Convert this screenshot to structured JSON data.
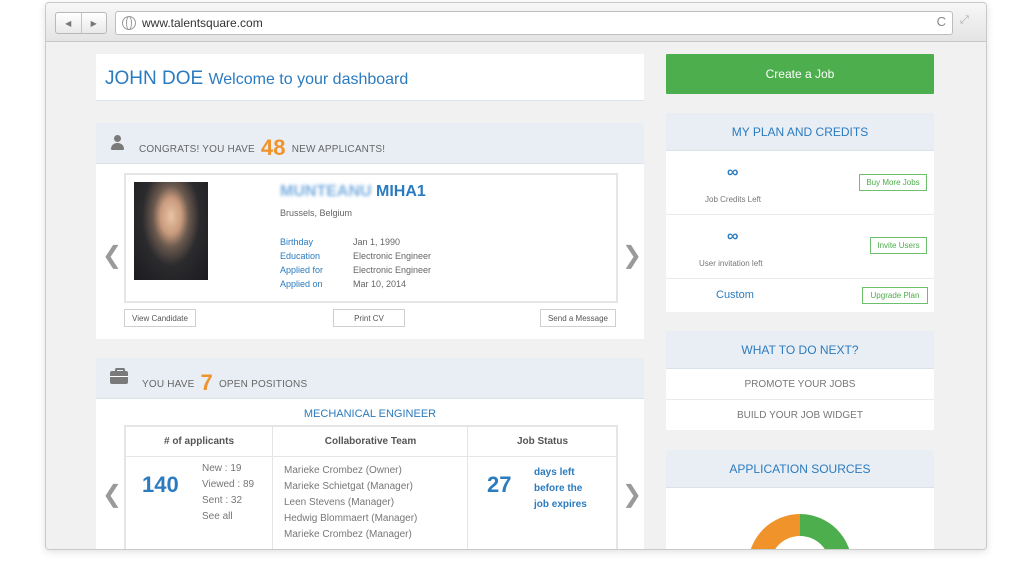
{
  "browser": {
    "url": "www.talentsquare.com",
    "back_icon": "◀",
    "forward_icon": "▶",
    "reload_icon": "C",
    "expand_icon": "⤢"
  },
  "welcome": {
    "name": "JOHN DOE",
    "message": "Welcome to your dashboard"
  },
  "create_job_label": "Create a Job",
  "applicants": {
    "prefix": "CONGRATS! YOU HAVE",
    "count": "48",
    "suffix": "NEW APPLICANTS!",
    "candidate": {
      "last_name": "MUNTEANU",
      "first_name": "MIHA1",
      "location": "Brussels, Belgium",
      "details": [
        {
          "label": "Birthday",
          "value": "Jan 1, 1990"
        },
        {
          "label": "Education",
          "value": "Electronic Engineer"
        },
        {
          "label": "Applied for",
          "value": "Electronic Engineer"
        },
        {
          "label": "Applied on",
          "value": "Mar 10, 2014"
        }
      ]
    },
    "view_candidate": "View Candidate",
    "print_cv": "Print CV",
    "send_message": "Send a Message",
    "prev_icon": "❮",
    "next_icon": "❯"
  },
  "positions": {
    "prefix": "YOU HAVE",
    "count": "7",
    "suffix": "OPEN POSITIONS",
    "title": "MECHANICAL ENGINEER",
    "headers": [
      "# of applicants",
      "Collaborative Team",
      "Job Status"
    ],
    "applicants_total": "140",
    "new": "New : 19",
    "viewed": "Viewed : 89",
    "sent": "Sent : 32",
    "see_all": "See all",
    "team": [
      "Marieke Crombez (Owner)",
      "Marieke Schietgat (Manager)",
      "Leen Stevens (Manager)",
      "Hedwig Blommaert (Manager)",
      "Marieke Crombez (Manager)"
    ],
    "days_left": "27",
    "days_text": [
      "days left",
      "before the",
      "job expires"
    ]
  },
  "plan": {
    "title": "MY PLAN AND CREDITS",
    "job_credits_value": "∞",
    "job_credits_label": "Job Credits Left",
    "buy_more": "Buy More Jobs",
    "invitations_value": "∞",
    "invitations_label": "User invitation left",
    "invite_users": "Invite Users",
    "plan_name": "Custom",
    "upgrade": "Upgrade Plan"
  },
  "next_steps": {
    "title": "WHAT TO DO NEXT?",
    "items": [
      "PROMOTE YOUR JOBS",
      "BUILD YOUR JOB WIDGET"
    ]
  },
  "sources": {
    "title": "APPLICATION SOURCES"
  },
  "colors": {
    "accent_blue": "#2b7bbf",
    "accent_green": "#4cae4c",
    "accent_orange": "#f0932b"
  }
}
